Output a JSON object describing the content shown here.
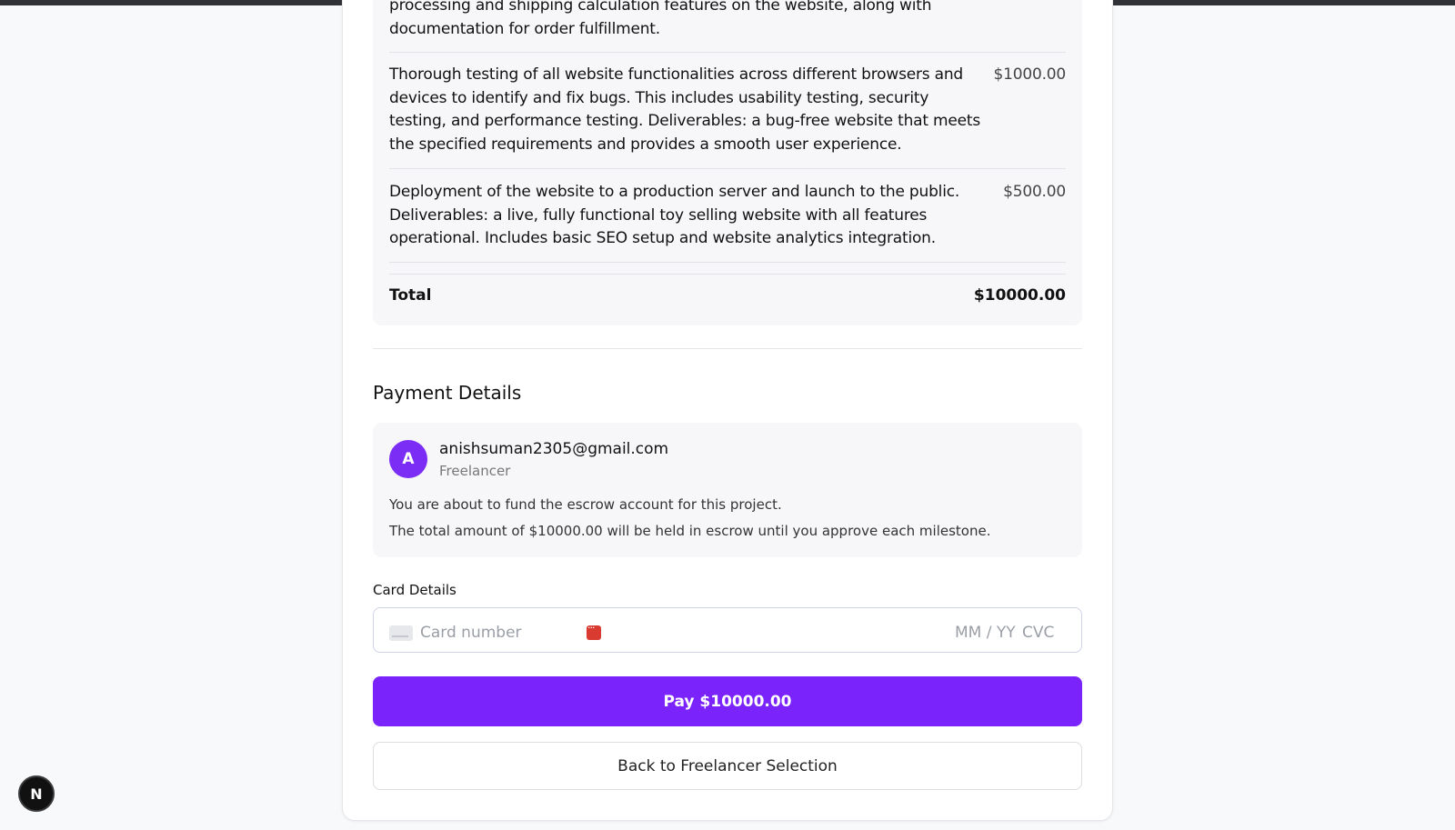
{
  "milestones": [
    {
      "description": "processing and shipping calculation features on the website, along with documentation for order fulfillment.",
      "price": ""
    },
    {
      "description": "Thorough testing of all website functionalities across different browsers and devices to identify and fix bugs. This includes usability testing, security testing, and performance testing. Deliverables: a bug-free website that meets the specified requirements and provides a smooth user experience.",
      "price": "$1000.00"
    },
    {
      "description": "Deployment of the website to a production server and launch to the public. Deliverables: a live, fully functional toy selling website with all features operational. Includes basic SEO setup and website analytics integration.",
      "price": "$500.00"
    }
  ],
  "total": {
    "label": "Total",
    "value": "$10000.00"
  },
  "payment": {
    "title": "Payment Details",
    "avatar_initial": "A",
    "email": "anishsuman2305@gmail.com",
    "role": "Freelancer",
    "info_line1": "You are about to fund the escrow account for this project.",
    "info_line2": "The total amount of $10000.00 will be held in escrow until you approve each milestone.",
    "card_label": "Card Details",
    "card_number_placeholder": "Card number",
    "expiry_placeholder": "MM / YY",
    "cvc_placeholder": "CVC",
    "pay_button": "Pay $10000.00",
    "back_button": "Back to Freelancer Selection"
  },
  "badge": {
    "letter": "N"
  },
  "colors": {
    "accent": "#7a23fb",
    "error": "#d93b30"
  }
}
